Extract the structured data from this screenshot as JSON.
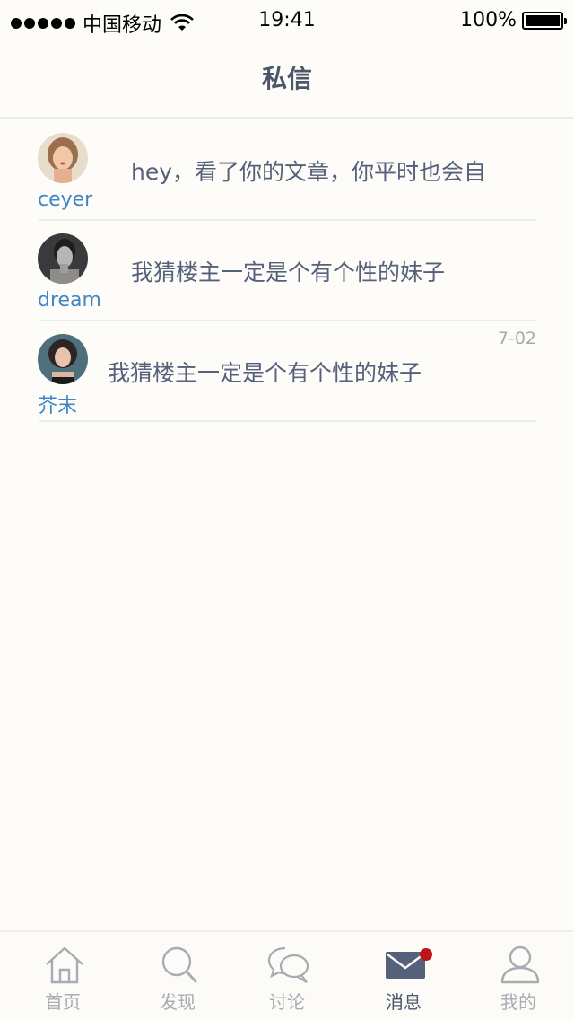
{
  "status_bar": {
    "carrier": "中国移动",
    "time": "19:41",
    "battery": "100%"
  },
  "header": {
    "title": "私信"
  },
  "messages": [
    {
      "username": "ceyer",
      "preview": "hey，看了你的文章，你平时也会自",
      "date": "",
      "avatar": "avatar-ceyer"
    },
    {
      "username": "dream",
      "preview": "我猜楼主一定是个有个性的妹子",
      "date": "",
      "avatar": "avatar-dream"
    },
    {
      "username": "芥末",
      "preview": "我猜楼主一定是个有个性的妹子",
      "date": "7-02",
      "avatar": "avatar-jiemo"
    }
  ],
  "tab_bar": {
    "items": [
      {
        "label": "首页",
        "icon": "home-icon"
      },
      {
        "label": "发现",
        "icon": "search-icon"
      },
      {
        "label": "讨论",
        "icon": "chat-bubbles-icon"
      },
      {
        "label": "消息",
        "icon": "mail-icon"
      },
      {
        "label": "我的",
        "icon": "user-icon"
      }
    ],
    "active": "消息"
  },
  "colors": {
    "background": "#fdfcf8",
    "accent_blue": "#3d87c7",
    "text_primary": "#4d5668",
    "text_secondary": "#55607a",
    "tab_inactive": "#a8abb2",
    "badge_red": "#c0141b"
  }
}
